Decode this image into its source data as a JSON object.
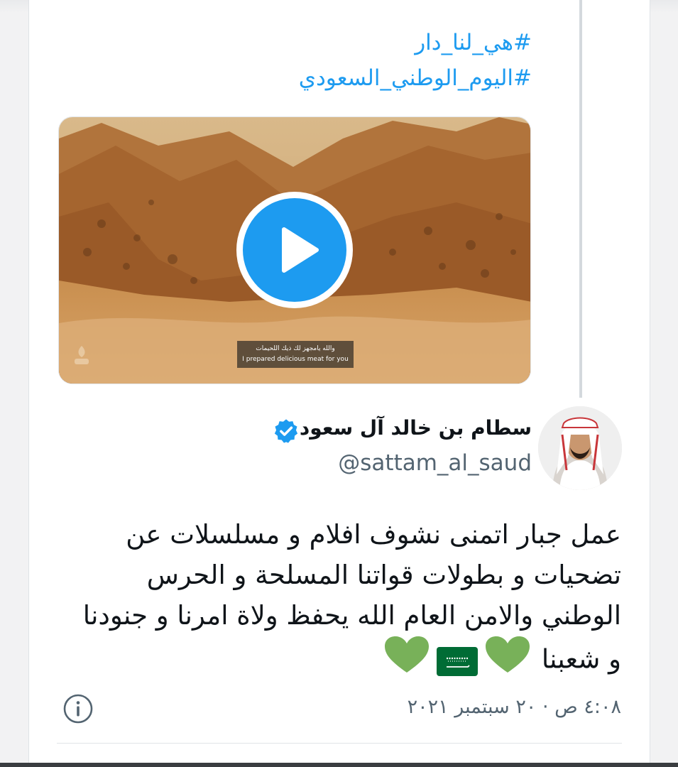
{
  "quoted_tweet": {
    "hashtags": [
      "#هي_لنا_دار",
      "#اليوم_الوطني_السعودي"
    ],
    "video": {
      "subtitle_ar": "والله يامجهز لك ذيك اللحيمات",
      "subtitle_en": "I prepared delicious meat for you"
    }
  },
  "tweet": {
    "display_name": "سطام بن خالد آل سعود",
    "handle": "@sattam_al_saud",
    "text": "عمل جبار اتمنى نشوف افلام و مسلسلات عن تضحيات و بطولات قواتنا المسلحة و الحرس الوطني والامن العام الله يحفظ ولاة امرنا و جنودنا و شعبنا",
    "emoji": [
      "green-heart",
      "saudi-flag",
      "green-heart"
    ],
    "timestamp": "٤:٠٨ ص · ٢٠ سبتمبر ٢٠٢١"
  },
  "icons": {
    "verified": "verified-badge-icon",
    "info": "info-icon",
    "play": "play-icon"
  },
  "colors": {
    "accent": "#1d9bf0",
    "text": "#0f1419",
    "secondary": "#536471",
    "heart": "#78b159",
    "flag": "#006c35"
  }
}
